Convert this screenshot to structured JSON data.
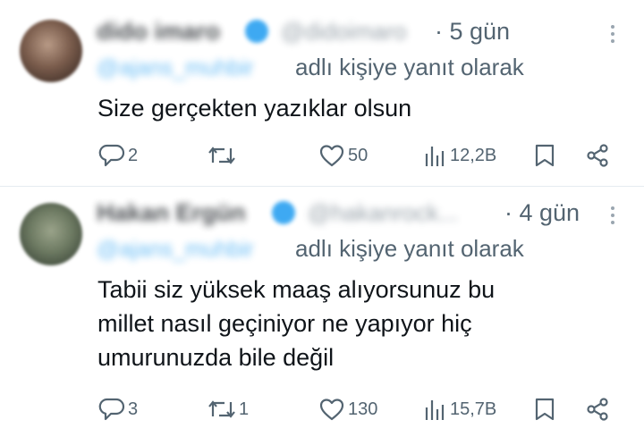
{
  "tweets": [
    {
      "name": "dido imaro",
      "handle": "@didoimaro",
      "time": "· 5 gün",
      "mention": "@ajans_muhbir",
      "reply_text": "adlı kişiye yanıt olarak",
      "text": "Size gerçekten yazıklar olsun",
      "actions": {
        "replies": "2",
        "retweets": "",
        "likes": "50",
        "views": "12,2B"
      }
    },
    {
      "name": "Hakan Ergün",
      "handle": "@hakanrock...",
      "time": "· 4 gün",
      "mention": "@ajans_muhbir",
      "reply_text": "adlı kişiye yanıt olarak",
      "text": "Tabii siz yüksek maaş alıyorsunuz bu\nmillet nasıl geçiniyor ne yapıyor hiç\numurunuzda bile değil",
      "actions": {
        "replies": "3",
        "retweets": "1",
        "likes": "130",
        "views": "15,7B"
      }
    }
  ],
  "icons": {
    "reply": "reply-icon",
    "retweet": "retweet-icon",
    "like": "heart-icon",
    "views": "views-icon",
    "bookmark": "bookmark-icon",
    "share": "share-icon",
    "more": "more-icon"
  },
  "colors": {
    "text": "#0f1419",
    "secondary": "#536471",
    "accent": "#1d9bf0",
    "divider": "#e6ecf0"
  }
}
